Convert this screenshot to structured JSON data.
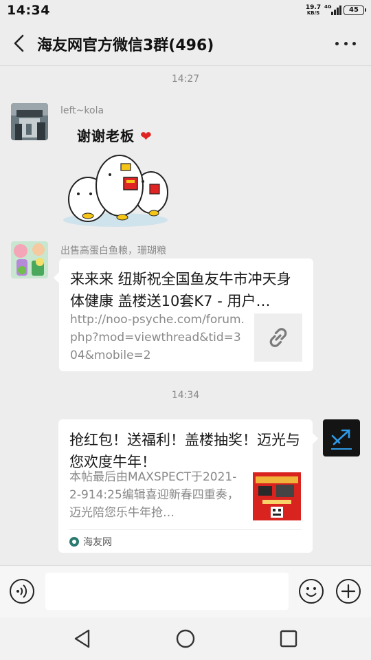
{
  "status_bar": {
    "time": "14:34",
    "net_speed_value": "19.7",
    "net_speed_unit": "KB/S",
    "network_type": "4G",
    "battery_level": "45"
  },
  "header": {
    "title": "海友网官方微信3群(496)"
  },
  "messages": [
    {
      "timestamp": "14:27"
    },
    {
      "sender": "left~kola",
      "sticker_text": "谢谢老板",
      "heart": "❤"
    },
    {
      "sender": "出售高蛋白鱼粮，珊瑚粮",
      "title": "来来来 纽斯祝全国鱼友牛市冲天身体健康 盖楼送10套K7 - 用户…",
      "description": "http://noo-psyche.com/forum.php?mod=viewthread&tid=304&mobile=2"
    },
    {
      "timestamp": "14:34"
    },
    {
      "title": "抢红包！送福利！盖楼抽奖！迈光与您欢度牛年！",
      "description": "本帖最后由MAXSPECT于2021-2-914:25编辑喜迎新春四重奏，迈光陪您乐牛年抢…",
      "source": "海友网"
    }
  ],
  "input": {
    "value": "",
    "placeholder": ""
  },
  "colors": {
    "background": "#ededed",
    "card": "#ffffff",
    "meta_text": "#8a8a8a",
    "heart": "#e02424"
  }
}
